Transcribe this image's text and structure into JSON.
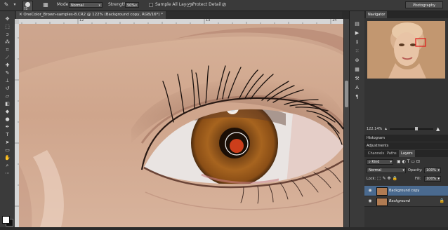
{
  "options_bar": {
    "brush_size": "75",
    "mode_label": "Mode:",
    "mode_value": "Normal",
    "strength_label": "Strength:",
    "strength_value": "50%",
    "sample_all_layers": "Sample All Layers",
    "sample_all_layers_checked": false,
    "protect_detail": "Protect Detail",
    "protect_detail_checked": true,
    "workspace": "Photography"
  },
  "document": {
    "tab_title": "OneColor_Brown-samples-8.CR2 @ 122% (Background copy, RGB/16*) *",
    "ruler_marks": [
      "12",
      "13",
      "14"
    ]
  },
  "navigator": {
    "title": "Navigator",
    "zoom": "122.14%"
  },
  "panels": {
    "histogram": "Histogram",
    "adjustments": "Adjustments",
    "tabs": [
      "Channels",
      "Paths",
      "Layers"
    ],
    "active_tab": "Layers"
  },
  "layers": {
    "kind_filter": "Kind",
    "blend_mode": "Normal",
    "opacity_label": "Opacity:",
    "opacity_value": "100%",
    "lock_label": "Lock:",
    "fill_label": "Fill:",
    "fill_value": "100%",
    "items": [
      {
        "name": "Background copy",
        "selected": true
      },
      {
        "name": "Background",
        "selected": false
      }
    ]
  },
  "colors": {
    "accent": "#4a6a8f",
    "ui_dark": "#2b2b2b",
    "skin": "#d9b49c",
    "iris": "#9a5a1c",
    "redeye": "#e0441e"
  }
}
